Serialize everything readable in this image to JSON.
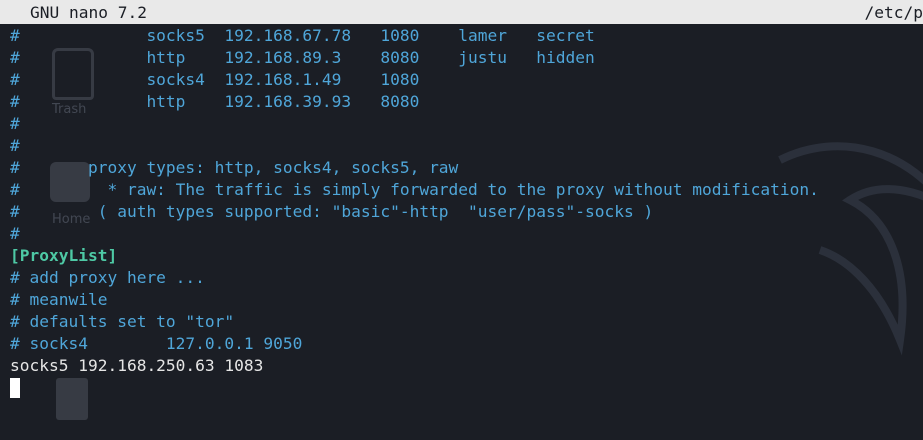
{
  "titlebar": {
    "app": "GNU nano 7.2",
    "path": "/etc/p"
  },
  "desktop": {
    "trash_label": "Trash",
    "home_label": "Home"
  },
  "lines": [
    "#             socks5  192.168.67.78   1080    lamer   secret",
    "#             http    192.168.89.3    8080    justu   hidden",
    "#             socks4  192.168.1.49    1080",
    "#             http    192.168.39.93   8080",
    "#",
    "#",
    "#       proxy types: http, socks4, socks5, raw",
    "#         * raw: The traffic is simply forwarded to the proxy without modification.",
    "#        ( auth types supported: \"basic\"-http  \"user/pass\"-socks )",
    "#",
    "[ProxyList]",
    "# add proxy here ...",
    "# meanwile",
    "# defaults set to \"tor\"",
    "# socks4        127.0.0.1 9050",
    "socks5 192.168.250.63 1083"
  ],
  "colors": {
    "comment": "#4fa6d9",
    "section": "#4ec9a5",
    "plain": "#e6e6e6",
    "titlebar_bg": "#e9e9e9"
  }
}
